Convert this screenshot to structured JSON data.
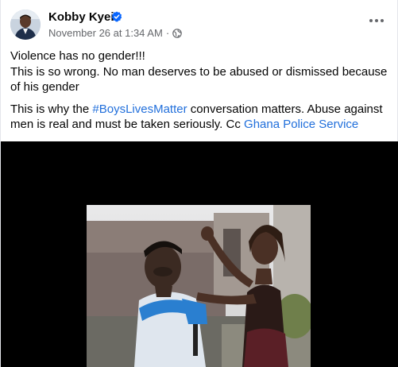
{
  "post": {
    "author": "Kobby Kyei",
    "timestamp": "November 26 at 1:34 AM",
    "separator": "·",
    "audience_icon": "globe-icon",
    "verified_icon": "verified-badge-icon",
    "more_icon": "more-options-icon",
    "line1": "Violence has no gender!!!",
    "line2": "This is so wrong. No man deserves to be abused or dismissed because of his gender",
    "para2_prefix": "This is why the ",
    "hashtag": "#BoysLivesMatter",
    "para2_middle": " conversation matters. Abuse against men is real and must be taken seriously. Cc ",
    "mention": "Ghana Police Service"
  },
  "colors": {
    "link": "#216fdb",
    "secondary_text": "#65676b",
    "verified": "#0866ff",
    "media_background": "#000000"
  }
}
